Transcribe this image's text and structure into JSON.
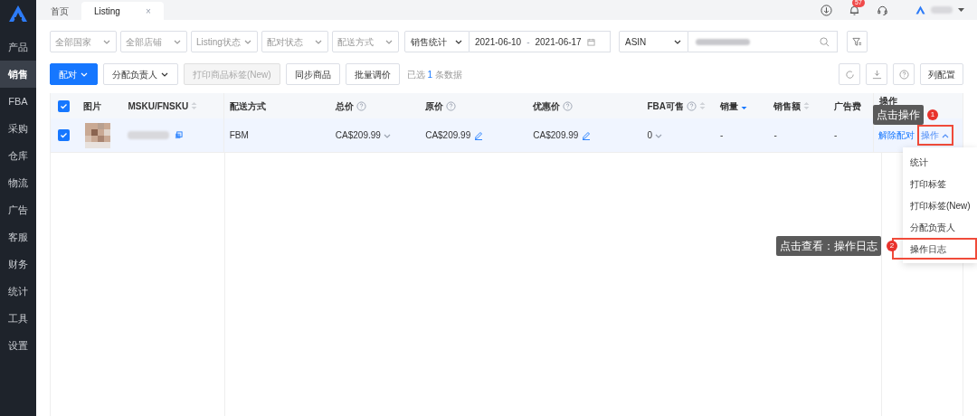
{
  "sidebar": {
    "items": [
      {
        "label": "产品",
        "selected": false
      },
      {
        "label": "销售",
        "selected": true
      },
      {
        "label": "FBA",
        "selected": false
      },
      {
        "label": "采购",
        "selected": false
      },
      {
        "label": "仓库",
        "selected": false
      },
      {
        "label": "物流",
        "selected": false
      },
      {
        "label": "广告",
        "selected": false
      },
      {
        "label": "客服",
        "selected": false
      },
      {
        "label": "财务",
        "selected": false
      },
      {
        "label": "统计",
        "selected": false
      },
      {
        "label": "工具",
        "selected": false
      },
      {
        "label": "设置",
        "selected": false
      }
    ]
  },
  "tabs": [
    {
      "label": "首页",
      "selected": false
    },
    {
      "label": "Listing",
      "selected": true,
      "close": "×"
    }
  ],
  "header": {
    "notification_count": "57"
  },
  "filters": {
    "selects": [
      "全部国家",
      "全部店铺",
      "Listing状态",
      "配对状态",
      "配送方式"
    ],
    "stat_select": "销售统计",
    "date_start": "2021-06-10",
    "date_sep": "-",
    "date_end": "2021-06-17",
    "search_type": "ASIN"
  },
  "actions": [
    {
      "label": "配对",
      "kind": "primary"
    },
    {
      "label": "分配负责人",
      "kind": "dropdown"
    },
    {
      "label": "打印商品标签(New)",
      "kind": "disabled"
    },
    {
      "label": "同步商品",
      "kind": "plain"
    },
    {
      "label": "批量调价",
      "kind": "plain"
    }
  ],
  "selection": {
    "prefix": "已选",
    "count": "1",
    "suffix": "条数据"
  },
  "config_button": "列配置",
  "table": {
    "all_checked": true,
    "columns": [
      {
        "label": "图片",
        "help": false,
        "sortable": false
      },
      {
        "label": "MSKU/FNSKU",
        "help": false,
        "sortable": true,
        "sorted": false
      },
      {
        "label": "配送方式",
        "help": false,
        "sortable": false
      },
      {
        "label": "总价",
        "help": true,
        "sortable": false
      },
      {
        "label": "原价",
        "help": true,
        "sortable": false
      },
      {
        "label": "优惠价",
        "help": true,
        "sortable": false
      },
      {
        "label": "FBA可售",
        "help": true,
        "sortable": true,
        "sorted": false
      },
      {
        "label": "销量",
        "help": false,
        "sortable": true,
        "sorted": true
      },
      {
        "label": "销售额",
        "help": false,
        "sortable": true,
        "sorted": false
      },
      {
        "label": "广告费",
        "help": false,
        "sortable": false
      },
      {
        "label": "操作",
        "help": false,
        "sortable": false
      }
    ],
    "rows": [
      {
        "checked": true,
        "shipping": "FBM",
        "total": "CA$209.99",
        "original": "CA$209.99",
        "deal": "CA$209.99",
        "fba": "0",
        "sales": "-",
        "revenue": "-",
        "ad_cost": "-",
        "unpair": "解除配对",
        "action": "操作"
      }
    ]
  },
  "menu": {
    "items": [
      {
        "label": "统计",
        "highlighted": false
      },
      {
        "label": "打印标签",
        "highlighted": false
      },
      {
        "label": "打印标签(New)",
        "highlighted": false
      },
      {
        "label": "分配负责人",
        "highlighted": false
      },
      {
        "label": "操作日志",
        "highlighted": true
      }
    ]
  },
  "callouts": [
    {
      "number": "1",
      "text": "点击操作"
    },
    {
      "number": "2",
      "text": "点击查看：操作日志"
    }
  ]
}
